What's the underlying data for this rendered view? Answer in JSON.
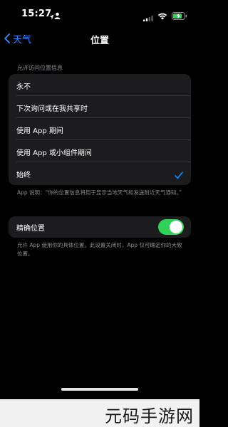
{
  "status_bar": {
    "time": "15:27",
    "icons": [
      "navigation-arrow-icon",
      "person-icon",
      "signal-icon",
      "wifi-icon",
      "battery-charging-icon"
    ]
  },
  "nav": {
    "back_label": "天气",
    "title": "位置"
  },
  "section_header": "允许访问位置信息",
  "options": [
    {
      "label": "永不",
      "selected": false
    },
    {
      "label": "下次询问或在我共享时",
      "selected": false
    },
    {
      "label": "使用 App 期间",
      "selected": false
    },
    {
      "label": "使用 App 或小组件期间",
      "selected": false
    },
    {
      "label": "始终",
      "selected": true
    }
  ],
  "footer_note": "App 说明：“你的位置信息将用于显示当地天气和发送附近天气通知。”",
  "precise": {
    "label": "精确位置",
    "enabled": true,
    "note": "允许 App 使用你的具体位置。此设置关闭时，App 仅可确定你的大致位置。"
  },
  "watermark": "元码手游网",
  "colors": {
    "accent": "#0a84ff",
    "toggle_on": "#30d158",
    "group_bg": "#1c1c1e",
    "secondary_text": "#8d8d93"
  }
}
